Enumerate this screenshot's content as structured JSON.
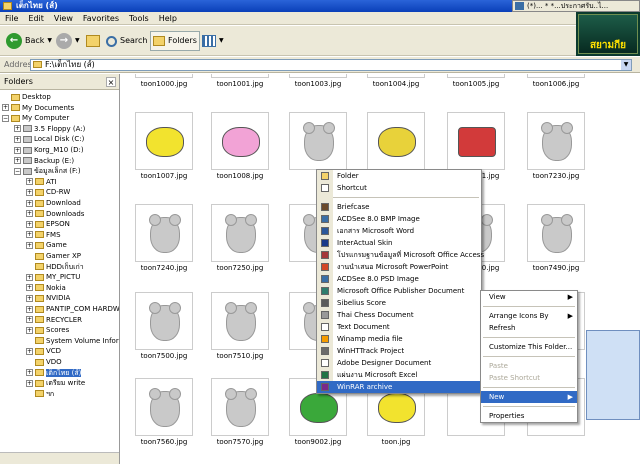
{
  "window": {
    "title": "เต็กไทย (ส์)"
  },
  "popup": {
    "text": "(*)... * *...ประกาศรับ..ไ..."
  },
  "menubar": {
    "items": [
      "File",
      "Edit",
      "View",
      "Favorites",
      "Tools",
      "Help"
    ]
  },
  "toolbar": {
    "back": "Back",
    "search": "Search",
    "folders": "Folders"
  },
  "address": {
    "label": "Address",
    "value": "F:\\เต็กไทย (ส์)"
  },
  "logo": {
    "text": "สยามกีย"
  },
  "folders_panel": {
    "title": "Folders",
    "items": [
      {
        "label": "Desktop",
        "pm": "",
        "icon": "folder"
      },
      {
        "label": "My Documents",
        "pm": "+",
        "icon": "folder"
      },
      {
        "label": "My Computer",
        "pm": "−",
        "icon": "folder"
      },
      {
        "label": "3.5 Floppy (A:)",
        "pm": "+",
        "icon": "drive"
      },
      {
        "label": "Local Disk (C:)",
        "pm": "+",
        "icon": "drive"
      },
      {
        "label": "Korg_M10 (D:)",
        "pm": "+",
        "icon": "drive"
      },
      {
        "label": "Backup (E:)",
        "pm": "+",
        "icon": "drive"
      },
      {
        "label": "ข้อมูลเล็กส (F:)",
        "pm": "−",
        "icon": "drive"
      },
      {
        "label": "ATI",
        "pm": "+",
        "icon": "folder"
      },
      {
        "label": "CD-RW",
        "pm": "+",
        "icon": "folder"
      },
      {
        "label": "Download",
        "pm": "+",
        "icon": "folder"
      },
      {
        "label": "Downloads",
        "pm": "+",
        "icon": "folder"
      },
      {
        "label": "EPSON",
        "pm": "+",
        "icon": "folder"
      },
      {
        "label": "FMS",
        "pm": "+",
        "icon": "folder"
      },
      {
        "label": "Game",
        "pm": "+",
        "icon": "folder"
      },
      {
        "label": "Gamer XP",
        "pm": "",
        "icon": "folder"
      },
      {
        "label": "HDDเก็บเก่า",
        "pm": "",
        "icon": "folder"
      },
      {
        "label": "MY_PICTU",
        "pm": "+",
        "icon": "folder"
      },
      {
        "label": "Nokia",
        "pm": "+",
        "icon": "folder"
      },
      {
        "label": "NVIDIA",
        "pm": "+",
        "icon": "folder"
      },
      {
        "label": "PANTIP_COM HARDW",
        "pm": "+",
        "icon": "folder"
      },
      {
        "label": "RECYCLER",
        "pm": "+",
        "icon": "folder"
      },
      {
        "label": "Scores",
        "pm": "+",
        "icon": "folder"
      },
      {
        "label": "System Volume Inform",
        "pm": "",
        "icon": "folder"
      },
      {
        "label": "VCD",
        "pm": "+",
        "icon": "folder"
      },
      {
        "label": "VDO",
        "pm": "",
        "icon": "folder"
      },
      {
        "label": "เต็กไทย (ส์)",
        "pm": "+",
        "icon": "folder"
      },
      {
        "label": "เตรียม write",
        "pm": "+",
        "icon": "folder"
      },
      {
        "label": "ฯก",
        "pm": "",
        "icon": "folder"
      }
    ]
  },
  "files": [
    {
      "name": "toon1000.jpg",
      "art": ""
    },
    {
      "name": "toon1001.jpg",
      "art": ""
    },
    {
      "name": "toon1003.jpg",
      "art": ""
    },
    {
      "name": "toon1004.jpg",
      "art": ""
    },
    {
      "name": "toon1005.jpg",
      "art": ""
    },
    {
      "name": "toon1006.jpg",
      "art": ""
    },
    {
      "name": "toon1007.jpg",
      "art": "butterfly"
    },
    {
      "name": "toon1008.jpg",
      "art": "rabbit"
    },
    {
      "name": "",
      "art": "bear"
    },
    {
      "name": "",
      "art": "fish"
    },
    {
      "name": "toon1011.jpg",
      "art": "truck"
    },
    {
      "name": "toon7230.jpg",
      "art": "bear"
    },
    {
      "name": "toon7240.jpg",
      "art": "bear"
    },
    {
      "name": "toon7250.jpg",
      "art": "bear"
    },
    {
      "name": "",
      "art": "bear"
    },
    {
      "name": "",
      "art": "bear"
    },
    {
      "name": "toon7450.jpg",
      "art": "bear"
    },
    {
      "name": "toon7490.jpg",
      "art": "bear"
    },
    {
      "name": "toon7500.jpg",
      "art": "bear"
    },
    {
      "name": "toon7510.jpg",
      "art": "bear"
    },
    {
      "name": "",
      "art": "bear"
    },
    {
      "name": "",
      "art": "bear"
    },
    {
      "name": "",
      "art": "bear"
    },
    {
      "name": "",
      "art": "bear"
    },
    {
      "name": "toon7560.jpg",
      "art": "bear"
    },
    {
      "name": "toon7570.jpg",
      "art": "bear"
    },
    {
      "name": "toon9002.jpg",
      "art": "frog"
    },
    {
      "name": "toon.jpg",
      "art": "bird"
    },
    {
      "name": "",
      "art": ""
    },
    {
      "name": "",
      "art": ""
    }
  ],
  "context_menu": {
    "items": [
      {
        "label": "View",
        "arrow": "▶",
        "state": ""
      },
      {
        "sep": true
      },
      {
        "label": "Arrange Icons By",
        "arrow": "▶",
        "state": ""
      },
      {
        "label": "Refresh",
        "arrow": "",
        "state": ""
      },
      {
        "sep": true
      },
      {
        "label": "Customize This Folder...",
        "arrow": "",
        "state": ""
      },
      {
        "sep": true
      },
      {
        "label": "Paste",
        "arrow": "",
        "state": "dis"
      },
      {
        "label": "Paste Shortcut",
        "arrow": "",
        "state": "dis"
      },
      {
        "sep": true
      },
      {
        "label": "New",
        "arrow": "▶",
        "state": "hl"
      },
      {
        "sep": true
      },
      {
        "label": "Properties",
        "arrow": "",
        "state": ""
      }
    ]
  },
  "new_submenu": {
    "items": [
      {
        "label": "Folder",
        "icon": "#f3d26a",
        "state": ""
      },
      {
        "label": "Shortcut",
        "icon": "#ffffff",
        "state": ""
      },
      {
        "sep": true
      },
      {
        "label": "Briefcase",
        "icon": "#6b4a2a",
        "state": ""
      },
      {
        "label": "ACDSee 8.0 BMP Image",
        "icon": "#3a6ea5",
        "state": ""
      },
      {
        "label": "เอกสาร Microsoft Word",
        "icon": "#2b579a",
        "state": ""
      },
      {
        "label": "InterActual Skin",
        "icon": "#1a3a8a",
        "state": ""
      },
      {
        "label": "โปรแกรมฐานข้อมูลที่ Microsoft Office Access",
        "icon": "#a4373a",
        "state": ""
      },
      {
        "label": "งานนำเสนอ Microsoft PowerPoint",
        "icon": "#d24726",
        "state": ""
      },
      {
        "label": "ACDSee 8.0 PSD Image",
        "icon": "#3a6ea5",
        "state": ""
      },
      {
        "label": "Microsoft Office Publisher Document",
        "icon": "#2e7d6e",
        "state": ""
      },
      {
        "label": "Sibelius Score",
        "icon": "#5a5a5a",
        "state": ""
      },
      {
        "label": "Thai Chess Document",
        "icon": "#999999",
        "state": ""
      },
      {
        "label": "Text Document",
        "icon": "#ffffff",
        "state": ""
      },
      {
        "label": "Winamp media file",
        "icon": "#f59b00",
        "state": ""
      },
      {
        "label": "WinHTTrack Project",
        "icon": "#6a6a6a",
        "state": ""
      },
      {
        "label": "Adobe Designer Document",
        "icon": "#ffffff",
        "state": ""
      },
      {
        "label": "แผ่นงาน Microsoft Excel",
        "icon": "#217346",
        "state": ""
      },
      {
        "label": "WinRAR archive",
        "icon": "#7a2a8a",
        "state": "hl"
      }
    ]
  }
}
